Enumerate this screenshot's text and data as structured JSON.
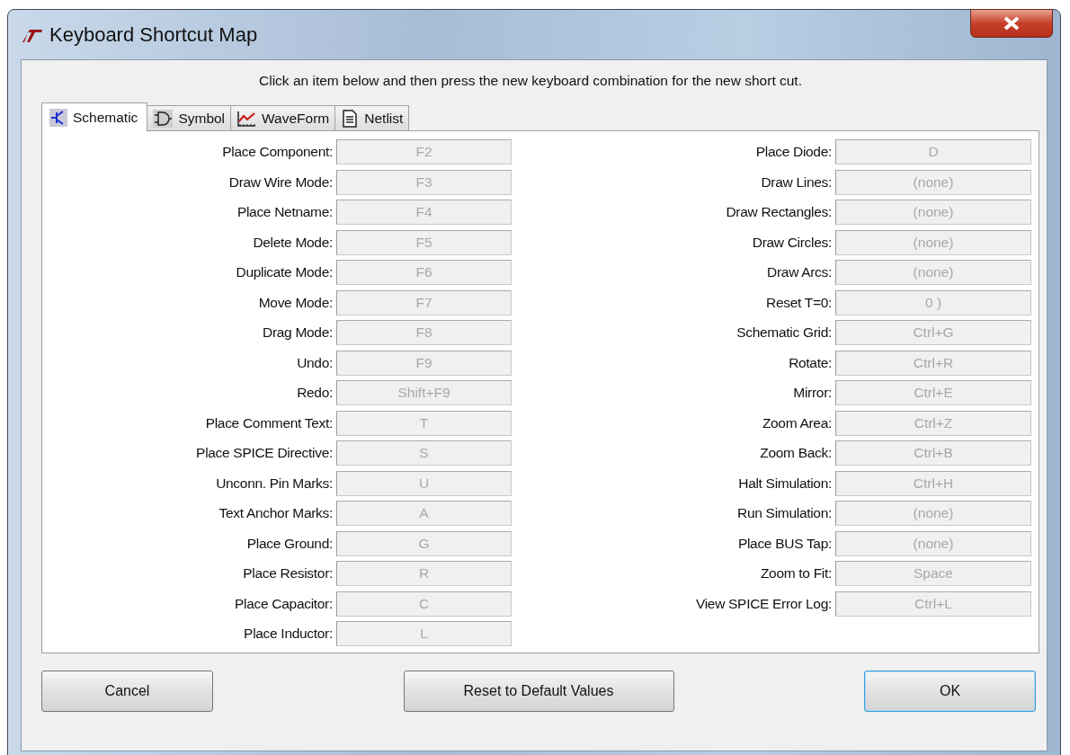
{
  "window": {
    "title": "Keyboard Shortcut Map"
  },
  "instruction": "Click an item below and then press the new keyboard combination for the new short cut.",
  "tabs": [
    {
      "label": "Schematic",
      "kind": "schematic",
      "selected": true
    },
    {
      "label": "Symbol",
      "kind": "symbol",
      "selected": false
    },
    {
      "label": "WaveForm",
      "kind": "waveform",
      "selected": false
    },
    {
      "label": "Netlist",
      "kind": "netlist",
      "selected": false
    }
  ],
  "columns": [
    {
      "rows": [
        {
          "label": "Place Component:",
          "value": "F2"
        },
        {
          "label": "Draw Wire Mode:",
          "value": "F3"
        },
        {
          "label": "Place Netname:",
          "value": "F4"
        },
        {
          "label": "Delete Mode:",
          "value": "F5"
        },
        {
          "label": "Duplicate Mode:",
          "value": "F6"
        },
        {
          "label": "Move Mode:",
          "value": "F7"
        },
        {
          "label": "Drag Mode:",
          "value": "F8"
        },
        {
          "label": "Undo:",
          "value": "F9"
        },
        {
          "label": "Redo:",
          "value": "Shift+F9"
        },
        {
          "label": "Place Comment Text:",
          "value": "T"
        },
        {
          "label": "Place SPICE Directive:",
          "value": "S"
        },
        {
          "label": "Unconn. Pin Marks:",
          "value": "U"
        },
        {
          "label": "Text Anchor Marks:",
          "value": "A"
        },
        {
          "label": "Place Ground:",
          "value": "G"
        },
        {
          "label": "Place Resistor:",
          "value": "R"
        },
        {
          "label": "Place Capacitor:",
          "value": "C"
        },
        {
          "label": "Place Inductor:",
          "value": "L"
        }
      ]
    },
    {
      "rows": [
        {
          "label": "Place Diode:",
          "value": "D"
        },
        {
          "label": "Draw Lines:",
          "value": "(none)"
        },
        {
          "label": "Draw Rectangles:",
          "value": "(none)"
        },
        {
          "label": "Draw Circles:",
          "value": "(none)"
        },
        {
          "label": "Draw Arcs:",
          "value": "(none)"
        },
        {
          "label": "Reset T=0:",
          "value": "0 )"
        },
        {
          "label": "Schematic Grid:",
          "value": "Ctrl+G"
        },
        {
          "label": "Rotate:",
          "value": "Ctrl+R"
        },
        {
          "label": "Mirror:",
          "value": "Ctrl+E"
        },
        {
          "label": "Zoom Area:",
          "value": "Ctrl+Z"
        },
        {
          "label": "Zoom Back:",
          "value": "Ctrl+B"
        },
        {
          "label": "Halt Simulation:",
          "value": "Ctrl+H"
        },
        {
          "label": "Run Simulation:",
          "value": "(none)"
        },
        {
          "label": "Place BUS Tap:",
          "value": "(none)"
        },
        {
          "label": "Zoom to Fit:",
          "value": "Space"
        },
        {
          "label": "View SPICE Error Log:",
          "value": "Ctrl+L"
        }
      ]
    }
  ],
  "buttons": [
    {
      "label": "Cancel",
      "kind": "normal"
    },
    {
      "label": "Reset to Default Values",
      "kind": "normal"
    },
    {
      "label": "OK",
      "kind": "default"
    }
  ]
}
